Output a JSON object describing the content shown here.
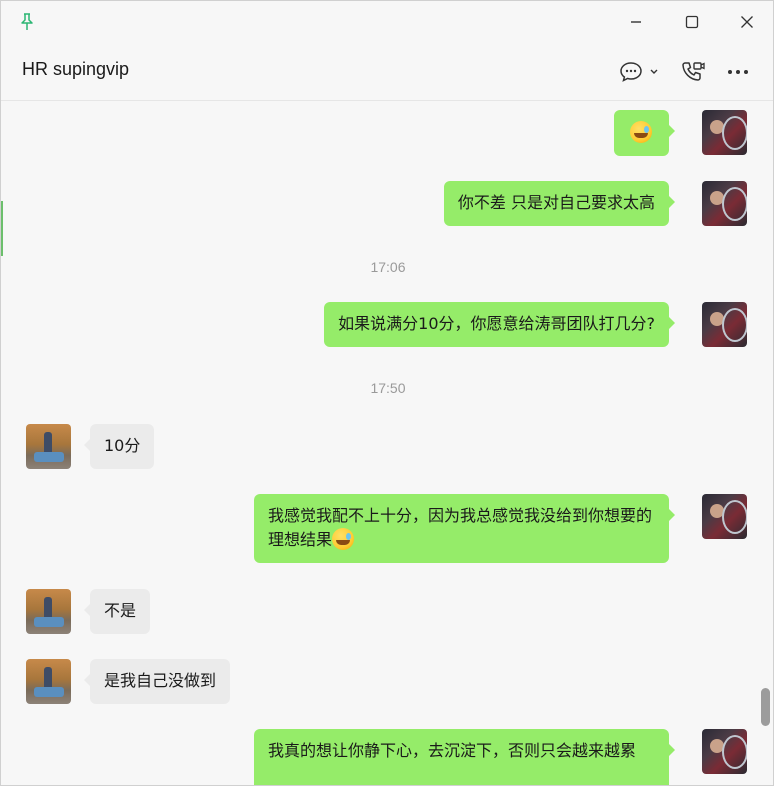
{
  "window": {
    "pin_icon": "pin-icon",
    "minimize_icon": "minimize-icon",
    "maximize_icon": "maximize-icon",
    "close_icon": "close-icon"
  },
  "header": {
    "title": "HR supingvip",
    "chat_options_icon": "chat-bubble-icon",
    "call_icon": "voice-video-call-icon",
    "more_icon": "more-icon"
  },
  "colors": {
    "my_bubble": "#95ec69",
    "their_bubble": "#ebebeb",
    "background": "#f7f7f7",
    "timestamp": "#9a9a9a"
  },
  "messages": [
    {
      "sender": "me",
      "text": "",
      "emoji": "rolling-laughing-emoji"
    },
    {
      "sender": "me",
      "text": "你不差 只是对自己要求太高"
    },
    {
      "type": "time",
      "text": "17:06"
    },
    {
      "sender": "me",
      "text": "如果说满分10分，你愿意给涛哥团队打几分?"
    },
    {
      "type": "time",
      "text": "17:50"
    },
    {
      "sender": "them",
      "text": "10分"
    },
    {
      "sender": "me",
      "text": "我感觉我配不上十分，因为我总感觉我没给到你想要的理想结果",
      "emoji": "rolling-laughing-emoji"
    },
    {
      "sender": "them",
      "text": "不是"
    },
    {
      "sender": "them",
      "text": "是我自己没做到"
    },
    {
      "sender": "me",
      "text": "我真的想让你静下心，去沉淀下，否则只会越来越累"
    }
  ]
}
